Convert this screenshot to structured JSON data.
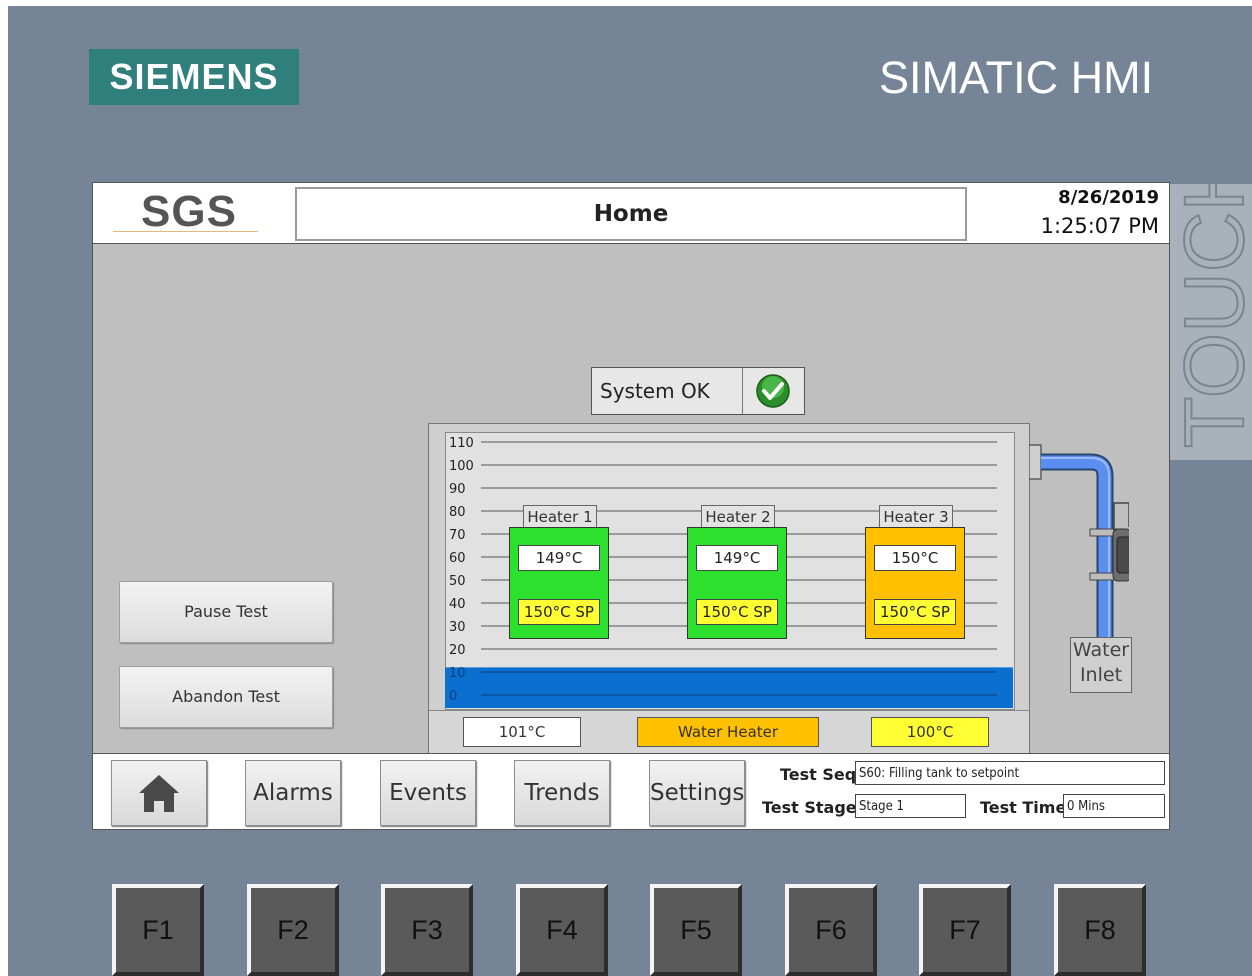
{
  "device": {
    "brand": "SIEMENS",
    "model": "SIMATIC HMI",
    "touch_label": "TOUCH"
  },
  "header": {
    "logo": "SGS",
    "title": "Home",
    "date": "8/26/2019",
    "time": "1:25:07 PM"
  },
  "status": {
    "label": "System OK",
    "icon": "check-icon"
  },
  "controls": {
    "pause": "Pause Test",
    "abandon": "Abandon Test"
  },
  "tank": {
    "scale_ticks": [
      "110",
      "100",
      "90",
      "80",
      "70",
      "60",
      "50",
      "40",
      "30",
      "20",
      "10",
      "0"
    ],
    "water_level_percent": 12,
    "heaters": [
      {
        "label": "Heater 1",
        "temp": "149°C",
        "setpoint": "150°C SP",
        "color": "#2ee02e"
      },
      {
        "label": "Heater 2",
        "temp": "149°C",
        "setpoint": "150°C SP",
        "color": "#2ee02e"
      },
      {
        "label": "Heater 3",
        "temp": "150°C",
        "setpoint": "150°C SP",
        "color": "#ffc000"
      }
    ],
    "water_temp": "101°C",
    "water_heater_label": "Water Heater",
    "water_heater_sp": "100°C",
    "inlet_label_line1": "Water",
    "inlet_label_line2": "Inlet"
  },
  "nav": {
    "home_icon": "home-icon",
    "alarms": "Alarms",
    "events": "Events",
    "trends": "Trends",
    "settings": "Settings"
  },
  "test_info": {
    "seq_label": "Test Seq",
    "seq_value": "S60: Filling tank to setpoint",
    "stage_label": "Test Stage",
    "stage_value": "Stage 1",
    "time_label": "Test Time",
    "time_value": "0 Mins"
  },
  "function_keys": [
    "F1",
    "F2",
    "F3",
    "F4",
    "F5",
    "F6",
    "F7",
    "F8"
  ],
  "colors": {
    "frame": "#758597",
    "logo_teal": "#2f7f7d",
    "water_blue": "#0a6fcf",
    "heater_ok": "#2ee02e",
    "heater_active": "#ffc000",
    "setpoint_yellow": "#ffff33"
  }
}
